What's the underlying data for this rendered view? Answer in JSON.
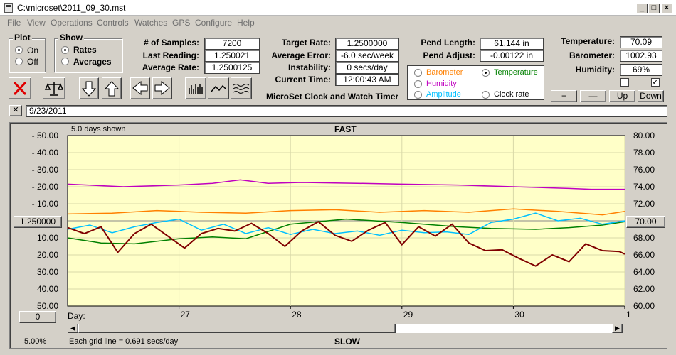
{
  "window": {
    "title": "C:\\microset\\2011_09_30.mst"
  },
  "menu": [
    "File",
    "View",
    "Operations",
    "Controls",
    "Watches",
    "GPS",
    "Configure",
    "Help"
  ],
  "plot_group": {
    "title": "Plot",
    "on": "On",
    "off": "Off",
    "selected": "On"
  },
  "show_group": {
    "title": "Show",
    "rates": "Rates",
    "averages": "Averages",
    "selected": "Rates"
  },
  "stats": {
    "samples_label": "# of Samples:",
    "samples": "7200",
    "last_reading_label": "Last Reading:",
    "last_reading": "1.250021",
    "avg_rate_label": "Average Rate:",
    "avg_rate": "1.2500125",
    "target_rate_label": "Target Rate:",
    "target_rate": "1.2500000",
    "avg_error_label": "Average Error:",
    "avg_error": "-6.0 sec/week",
    "instability_label": "Instability:",
    "instability": "0 secs/day",
    "current_time_label": "Current Time:",
    "current_time": "12:00:43 AM",
    "pend_length_label": "Pend Length:",
    "pend_length": "61.144 in",
    "pend_adjust_label": "Pend Adjust:",
    "pend_adjust": "-0.00122 in",
    "temperature_label": "Temperature:",
    "temperature": "70.09",
    "barometer_label": "Barometer:",
    "barometer": "1002.93",
    "humidity_label": "Humidity:",
    "humidity": "69%"
  },
  "app_name": "MicroSet Clock and Watch Timer",
  "sensor_options": {
    "barometer": "Barometer",
    "temperature": "Temperature",
    "humidity": "Humidity",
    "amplitude": "Amplitude",
    "clock_rate": "Clock rate",
    "selected": "Temperature"
  },
  "side_buttons": {
    "plus": "+",
    "minus": "—",
    "up": "Up",
    "down": "Down"
  },
  "note": {
    "close": "✕",
    "date": "9/23/2011"
  },
  "graph": {
    "days_shown": "5.0 days shown",
    "top_label": "FAST",
    "bottom_label": "SLOW",
    "grid_note": "Each grid line = 0.691 secs/day",
    "zoom": "5.00%",
    "center_left": "1.250000",
    "center_right": "70.00",
    "bottom_left_btn": "0",
    "day_label": "Day:"
  },
  "colors": {
    "plot_bg": "#ffffc8",
    "rate": "#800000",
    "barometer": "#ff8000",
    "temperature": "#008000",
    "humidity": "#c000c0",
    "amplitude": "#00c0ff"
  },
  "chart_data": {
    "type": "line",
    "title": "FAST",
    "xlabel": "Day:",
    "x_ticks": [
      "27",
      "28",
      "29",
      "30",
      "1"
    ],
    "left_axis_ticks": [
      "- 50.00",
      "- 40.00",
      "- 30.00",
      "- 20.00",
      "- 10.00",
      "1.250000",
      "10.00",
      "20.00",
      "30.00",
      "40.00",
      "50.00"
    ],
    "right_axis_ticks": [
      "80.00",
      "78.00",
      "76.00",
      "74.00",
      "72.00",
      "70.00",
      "68.00",
      "66.00",
      "64.00",
      "62.00",
      "60.00"
    ],
    "right_ylim": [
      60,
      80
    ],
    "x_range_days": [
      26.0,
      31.0
    ],
    "series": [
      {
        "name": "Humidity",
        "color": "#c000c0",
        "x": [
          26.0,
          26.5,
          27.0,
          27.3,
          27.55,
          27.8,
          28.1,
          28.6,
          29.0,
          29.5,
          30.0,
          30.5,
          30.7,
          31.0
        ],
        "values": [
          74.3,
          74.0,
          74.2,
          74.4,
          74.8,
          74.4,
          74.5,
          74.4,
          74.3,
          74.2,
          74.0,
          73.8,
          73.7,
          73.7
        ]
      },
      {
        "name": "Barometer",
        "color": "#ff8000",
        "x": [
          26.0,
          26.4,
          26.8,
          27.2,
          27.6,
          28.0,
          28.4,
          28.8,
          29.2,
          29.6,
          30.0,
          30.4,
          30.8,
          31.0
        ],
        "values": [
          70.8,
          70.9,
          71.2,
          71.0,
          70.9,
          71.2,
          71.3,
          71.0,
          71.2,
          71.0,
          71.4,
          71.1,
          70.7,
          71.1
        ]
      },
      {
        "name": "Temperature",
        "color": "#008000",
        "x": [
          26.0,
          26.3,
          26.6,
          27.0,
          27.3,
          27.6,
          28.0,
          28.5,
          29.0,
          29.5,
          29.8,
          30.2,
          30.5,
          30.8,
          31.0
        ],
        "values": [
          68.0,
          67.4,
          67.3,
          67.9,
          68.1,
          67.9,
          69.6,
          70.2,
          69.8,
          69.3,
          69.1,
          69.0,
          69.2,
          69.5,
          69.9
        ]
      },
      {
        "name": "Amplitude",
        "color": "#00c0ff",
        "x": [
          26.0,
          26.2,
          26.4,
          26.6,
          26.8,
          27.0,
          27.2,
          27.4,
          27.6,
          27.8,
          28.0,
          28.2,
          28.4,
          28.6,
          28.8,
          29.0,
          29.2,
          29.4,
          29.6,
          29.8,
          30.0,
          30.2,
          30.4,
          30.6,
          30.8,
          31.0
        ],
        "values": [
          69.0,
          69.5,
          68.6,
          69.3,
          69.8,
          70.2,
          68.9,
          69.6,
          68.5,
          69.2,
          68.4,
          69.0,
          68.5,
          68.8,
          68.3,
          68.9,
          68.6,
          68.7,
          68.4,
          69.8,
          70.2,
          70.9,
          70.0,
          70.3,
          69.6,
          70.0
        ]
      },
      {
        "name": "Rate",
        "color": "#800000",
        "x": [
          26.0,
          26.15,
          26.3,
          26.45,
          26.6,
          26.75,
          26.9,
          27.05,
          27.2,
          27.35,
          27.5,
          27.65,
          27.8,
          27.95,
          28.1,
          28.25,
          28.4,
          28.55,
          28.7,
          28.85,
          29.0,
          29.15,
          29.3,
          29.45,
          29.6,
          29.75,
          29.9,
          30.05,
          30.2,
          30.35,
          30.5,
          30.65,
          30.8,
          30.95,
          31.0
        ],
        "values": [
          69.2,
          68.5,
          69.3,
          66.3,
          68.5,
          69.6,
          68.2,
          66.8,
          68.5,
          69.1,
          68.8,
          69.7,
          68.5,
          67.0,
          68.8,
          69.9,
          68.3,
          67.6,
          68.9,
          69.8,
          67.2,
          69.3,
          68.2,
          69.6,
          67.4,
          66.5,
          66.6,
          65.6,
          64.7,
          66.0,
          65.2,
          67.3,
          66.5,
          66.4,
          66.1
        ]
      }
    ]
  }
}
